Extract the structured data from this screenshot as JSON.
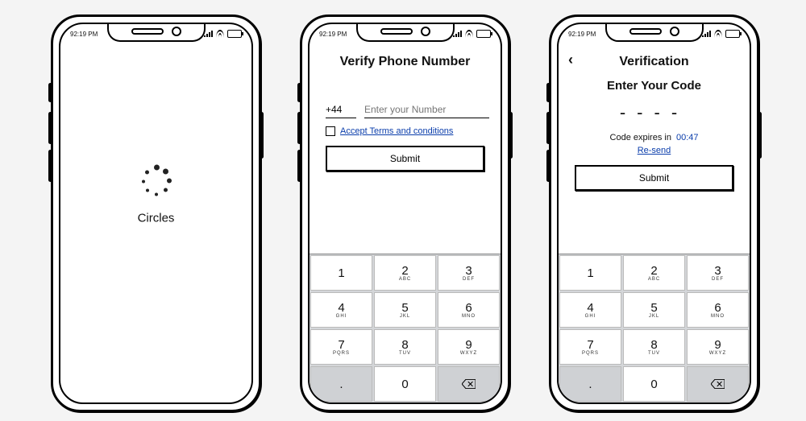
{
  "status": {
    "time": "92:19 PM"
  },
  "splash": {
    "app_name": "Circles"
  },
  "verify": {
    "title": "Verify Phone Number",
    "country_code": "+44",
    "phone_placeholder": "Enter your Number",
    "terms_label": "Accept Terms and conditions",
    "submit": "Submit"
  },
  "code": {
    "title": "Verification",
    "subtitle": "Enter Your Code",
    "dashes": "----",
    "expire_prefix": "Code expires in",
    "expire_time": "00:47",
    "resend": "Re-send",
    "submit": "Submit"
  },
  "keypad": {
    "k1": {
      "d": "1",
      "l": ""
    },
    "k2": {
      "d": "2",
      "l": "ABC"
    },
    "k3": {
      "d": "3",
      "l": "DEF"
    },
    "k4": {
      "d": "4",
      "l": "GHI"
    },
    "k5": {
      "d": "5",
      "l": "JKL"
    },
    "k6": {
      "d": "6",
      "l": "MNO"
    },
    "k7": {
      "d": "7",
      "l": "PQRS"
    },
    "k8": {
      "d": "8",
      "l": "TUV"
    },
    "k9": {
      "d": "9",
      "l": "WXYZ"
    },
    "dot": ".",
    "k0": "0"
  }
}
